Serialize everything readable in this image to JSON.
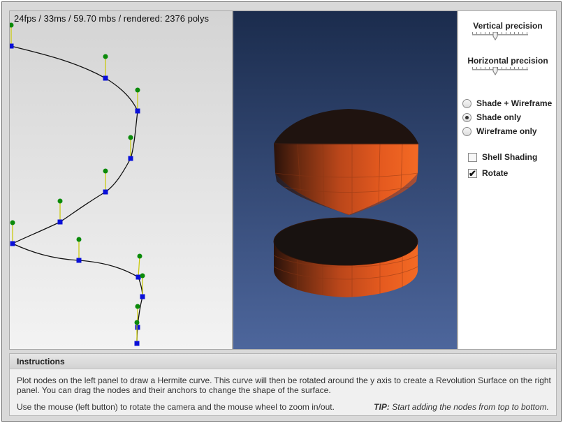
{
  "stats": "24fps / 33ms / 59.70 mbs / rendered: 2376 polys",
  "controls": {
    "vertical_precision_label": "Vertical precision",
    "horizontal_precision_label": "Horizontal precision",
    "vertical_precision_level": 0.4,
    "horizontal_precision_level": 0.4,
    "render_modes": [
      {
        "label": "Shade + Wireframe",
        "selected": false
      },
      {
        "label": "Shade only",
        "selected": true
      },
      {
        "label": "Wireframe only",
        "selected": false
      }
    ],
    "shell_shading": {
      "label": "Shell Shading",
      "checked": false
    },
    "rotate": {
      "label": "Rotate",
      "checked": true
    }
  },
  "instructions": {
    "title": "Instructions",
    "text": "Plot nodes on the left panel to draw a Hermite curve. This curve will then be rotated around the y axis to create a Revolution Surface on the right panel. You can drag the nodes and their anchors to change the shape of the surface.",
    "mouse_text": "Use the mouse (left button) to rotate the camera and the mouse wheel to zoom in/out.",
    "tip_label": "TIP:",
    "tip_text": "Start adding the nodes from top to bottom."
  },
  "colors": {
    "node": "#0a10d8",
    "anchor": "#0a8a0a",
    "anchor_line": "#c8c800",
    "surface_orange": "#e65a1c",
    "view_bg_top": "#1b2c4d",
    "view_bg_bottom": "#4d669c"
  }
}
